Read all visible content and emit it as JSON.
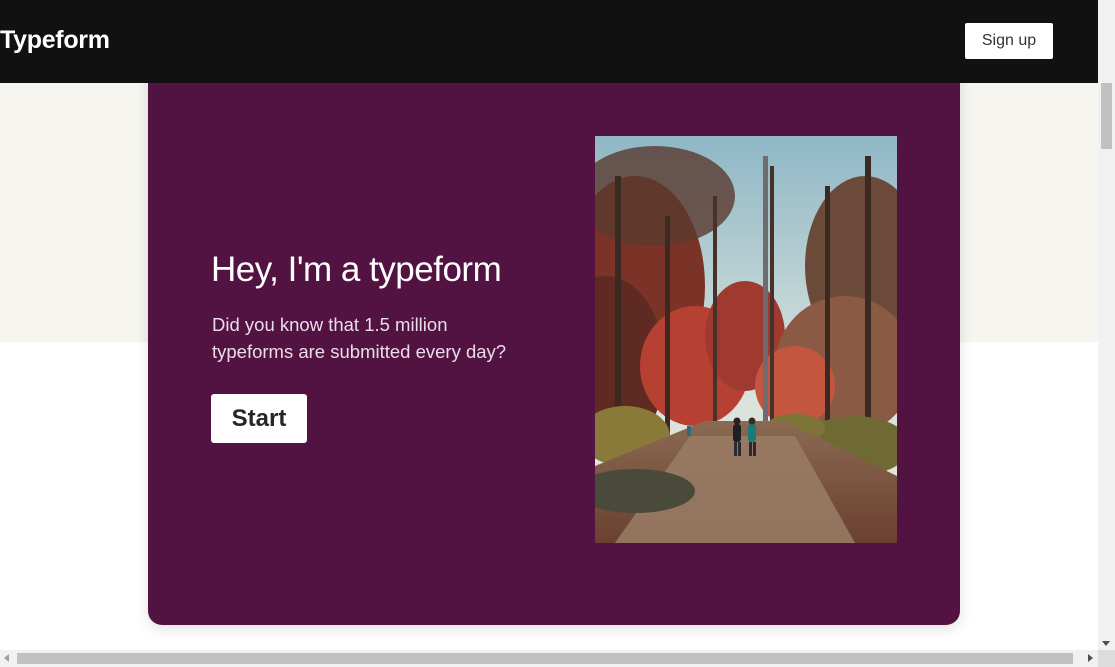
{
  "header": {
    "logo_text": "Typeform",
    "signup_label": "Sign up"
  },
  "hero": {
    "headline": "Hey, I'm a typeform",
    "subtext": "Did you know that 1.5 million typeforms are submitted every day?",
    "start_label": "Start",
    "image_icon": "autumn-park-photo"
  },
  "colors": {
    "header_bg": "#111111",
    "card_bg": "#521343",
    "page_band": "#f6f5f0",
    "button_bg": "#ffffff"
  }
}
